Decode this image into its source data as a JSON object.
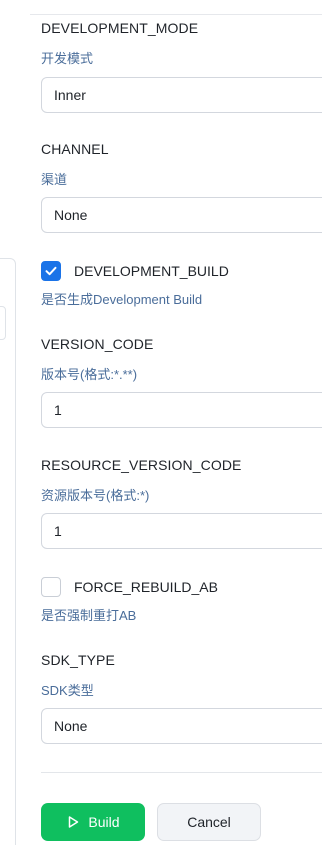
{
  "fields": {
    "development_mode": {
      "label": "DEVELOPMENT_MODE",
      "desc": "开发模式",
      "value": "Inner"
    },
    "channel": {
      "label": "CHANNEL",
      "desc": "渠道",
      "value": "None"
    },
    "development_build": {
      "label": "DEVELOPMENT_BUILD",
      "desc": "是否生成Development Build",
      "checked": true
    },
    "version_code": {
      "label": "VERSION_CODE",
      "desc": "版本号(格式:*.**)",
      "value": "1"
    },
    "resource_version_code": {
      "label": "RESOURCE_VERSION_CODE",
      "desc": "资源版本号(格式:*)",
      "value": "1"
    },
    "force_rebuild_ab": {
      "label": "FORCE_REBUILD_AB",
      "desc": "是否强制重打AB",
      "checked": false
    },
    "sdk_type": {
      "label": "SDK_TYPE",
      "desc": "SDK类型",
      "value": "None"
    }
  },
  "actions": {
    "build_label": "Build",
    "cancel_label": "Cancel"
  },
  "colors": {
    "accent": "#1a73e8",
    "build_green": "#0fbf5f",
    "desc_text": "#4a6d9a"
  },
  "icons": {
    "build": "play-icon",
    "checkbox_checked": "check-icon"
  }
}
